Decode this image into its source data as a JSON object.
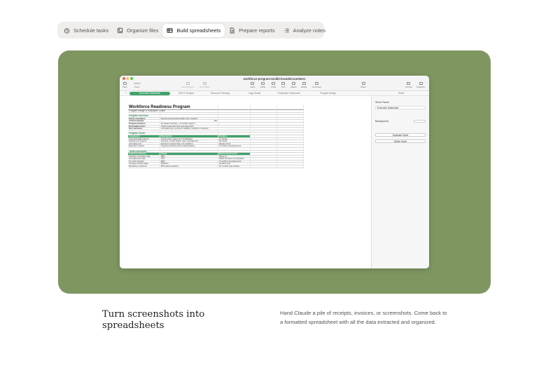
{
  "tabs": [
    {
      "label": "Schedule tasks",
      "icon": "schedule-icon",
      "active": false
    },
    {
      "label": "Organize files",
      "icon": "folder-icon",
      "active": false
    },
    {
      "label": "Build spreadsheets",
      "icon": "spreadsheet-icon",
      "active": true
    },
    {
      "label": "Prepare reports",
      "icon": "report-icon",
      "active": false
    },
    {
      "label": "Analyze notes",
      "icon": "notes-icon",
      "active": false
    }
  ],
  "colors": {
    "stage": "#7f9661",
    "accent_green": "#3fa36a",
    "tab_bg": "#efeeea"
  },
  "window": {
    "title": "workforce-program-toolkit-branded.numbers",
    "toolbar": {
      "view": "View",
      "zoom": "125% ▾",
      "zoom_label": "Zoom",
      "add_category": "Add Category",
      "pivot_table": "Pivot Table",
      "insert": "Insert",
      "table": "Table",
      "chart": "Chart",
      "text": "Text",
      "shape": "Shape",
      "media": "Media",
      "comment": "Comment",
      "share": "Share",
      "format": "Format",
      "organize": "Organize"
    },
    "sheet_tabs": [
      "Executive Dashboard",
      "SWOT Analysis",
      "Resource Planning",
      "Logic Model",
      "Evaluation Framework",
      "Program Design"
    ],
    "sheet_tab_add": "+",
    "sidebar": {
      "tab": "Sheet",
      "sheet_name_label": "Sheet Name",
      "sheet_name_value": "Executive Dashboard",
      "background_label": "Background",
      "duplicate": "Duplicate Sheet",
      "delete": "Delete Sheet"
    }
  },
  "sheet": {
    "title": "Workforce Readiness Program",
    "subtitle": "Program Design & Evaluation Toolkit",
    "overview_title": "Program overview",
    "overview": [
      [
        "Target population",
        "Reentry/incarcerated adults (18+) seeking",
        ""
      ],
      [
        "Annual capacity",
        "",
        "120"
      ],
      [
        "Program duration",
        "12 weeks intensive + 6 months support",
        ""
      ],
      [
        "Geographic focus",
        "Urban areas with high unemployment",
        ""
      ],
      [
        "Key outcomes",
        "Job placement, economic stability, recidivism reduction",
        ""
      ]
    ],
    "model_title": "Program model",
    "model_header": [
      "Component",
      "Description",
      "Duration"
    ],
    "model": [
      [
        "Technical skills training",
        "Construction trades & IT certification",
        "12 weeks"
      ],
      [
        "Wraparound support",
        "Housing, mental health, case management",
        "18 weeks"
      ],
      [
        "Job placement",
        "Employer partnerships, job matching",
        "Weeks 10-12"
      ],
      [
        "Retention support",
        "Ongoing coaching and troubleshooting",
        "6 months post-placement"
      ]
    ],
    "outcomes_title": "Target outcomes",
    "outcomes_header": [
      "Outcome measure",
      "Target",
      "Measurement point"
    ],
    "outcomes": [
      [
        "Program completion rate",
        "85%",
        "Week 12"
      ],
      [
        "Job placement rate",
        "75%",
        "Within 30 days of completion"
      ],
      [
        "6-month retention",
        "80%",
        "6 months post-placement"
      ],
      [
        "Average starting wage",
        "$18/hour",
        "At placement"
      ],
      [
        "Recidivism reduction",
        "50% below baseline",
        "12 months post-release"
      ]
    ]
  },
  "caption": {
    "headline": "Turn screenshots into spreadsheets",
    "description": "Hand Claude a pile of receipts, invoices, or screenshots. Come back to a formatted spreadsheet with all the data extracted and organized."
  }
}
